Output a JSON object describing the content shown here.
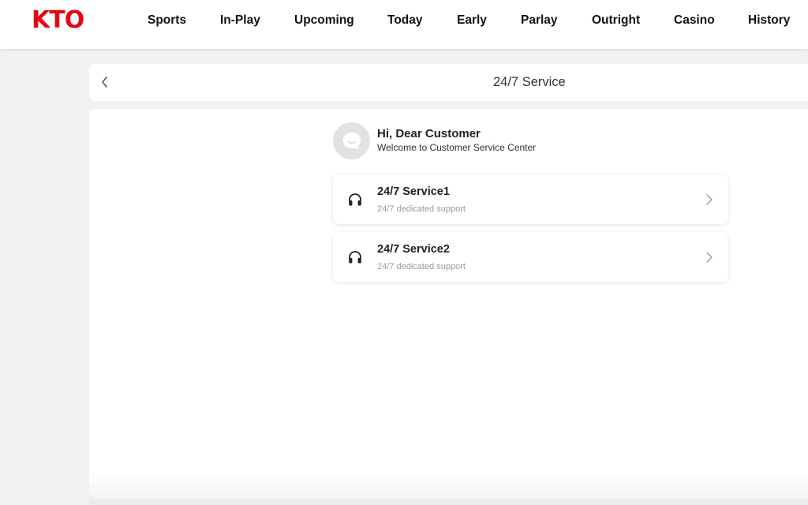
{
  "brand": {
    "logo_text": "KTO",
    "color": "#e30613"
  },
  "nav": {
    "items": [
      {
        "label": "Sports"
      },
      {
        "label": "In-Play"
      },
      {
        "label": "Upcoming"
      },
      {
        "label": "Today"
      },
      {
        "label": "Early"
      },
      {
        "label": "Parlay"
      },
      {
        "label": "Outright"
      },
      {
        "label": "Casino"
      },
      {
        "label": "History"
      }
    ]
  },
  "header": {
    "title": "24/7 Service",
    "back_icon": "chevron-left-icon"
  },
  "greeting": {
    "title": "Hi, Dear Customer",
    "subtitle": "Welcome to Customer Service Center",
    "avatar_icon": "chat-bubble-icon"
  },
  "services": [
    {
      "title": "24/7 Service1",
      "subtitle": "24/7 dedicated support",
      "icon": "headset-icon"
    },
    {
      "title": "24/7 Service2",
      "subtitle": "24/7 dedicated support",
      "icon": "headset-icon"
    }
  ]
}
